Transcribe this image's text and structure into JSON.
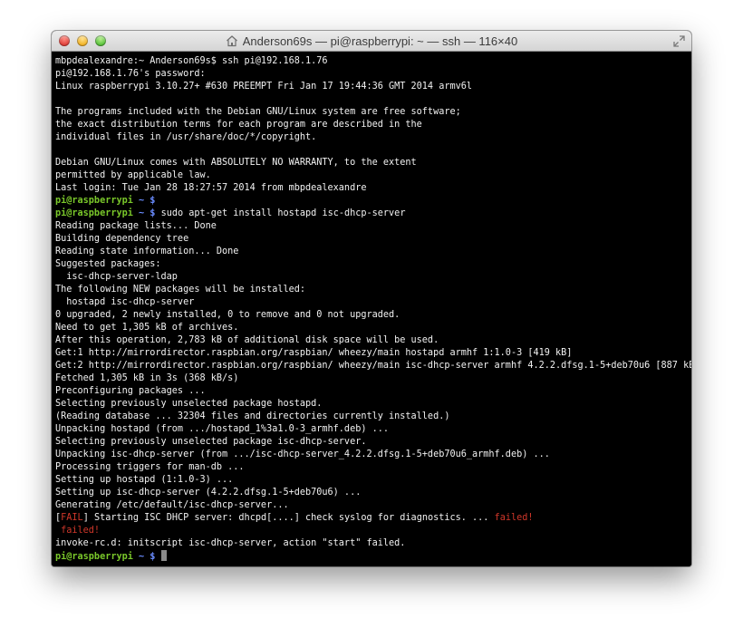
{
  "window": {
    "title": "Anderson69s — pi@raspberrypi: ~ — ssh — 116×40"
  },
  "prompt": {
    "user_host": "pi@raspberrypi",
    "dir": "~",
    "symbol": "$",
    "command": "sudo apt-get install hostapd isc-dhcp-server"
  },
  "terminal": {
    "lines": [
      "mbpdealexandre:~ Anderson69s$ ssh pi@192.168.1.76",
      "pi@192.168.1.76's password:",
      "Linux raspberrypi 3.10.27+ #630 PREEMPT Fri Jan 17 19:44:36 GMT 2014 armv6l",
      "",
      "The programs included with the Debian GNU/Linux system are free software;",
      "the exact distribution terms for each program are described in the",
      "individual files in /usr/share/doc/*/copyright.",
      "",
      "Debian GNU/Linux comes with ABSOLUTELY NO WARRANTY, to the extent",
      "permitted by applicable law.",
      "Last login: Tue Jan 28 18:27:57 2014 from mbpdealexandre"
    ],
    "output": [
      "Reading package lists... Done",
      "Building dependency tree",
      "Reading state information... Done",
      "Suggested packages:",
      "  isc-dhcp-server-ldap",
      "The following NEW packages will be installed:",
      "  hostapd isc-dhcp-server",
      "0 upgraded, 2 newly installed, 0 to remove and 0 not upgraded.",
      "Need to get 1,305 kB of archives.",
      "After this operation, 2,783 kB of additional disk space will be used.",
      "Get:1 http://mirrordirector.raspbian.org/raspbian/ wheezy/main hostapd armhf 1:1.0-3 [419 kB]",
      "Get:2 http://mirrordirector.raspbian.org/raspbian/ wheezy/main isc-dhcp-server armhf 4.2.2.dfsg.1-5+deb70u6 [887 kB]",
      "Fetched 1,305 kB in 3s (368 kB/s)",
      "Preconfiguring packages ...",
      "Selecting previously unselected package hostapd.",
      "(Reading database ... 32304 files and directories currently installed.)",
      "Unpacking hostapd (from .../hostapd_1%3a1.0-3_armhf.deb) ...",
      "Selecting previously unselected package isc-dhcp-server.",
      "Unpacking isc-dhcp-server (from .../isc-dhcp-server_4.2.2.dfsg.1-5+deb70u6_armhf.deb) ...",
      "Processing triggers for man-db ...",
      "Setting up hostapd (1:1.0-3) ...",
      "Setting up isc-dhcp-server (4.2.2.dfsg.1-5+deb70u6) ...",
      "Generating /etc/default/isc-dhcp-server..."
    ],
    "fail_line": {
      "open_bracket": "[",
      "fail": "FAIL",
      "rest": "] Starting ISC DHCP server: dhcpd[....] check syslog for diagnostics. ... ",
      "failed": "failed!"
    },
    "failed_again": " failed!",
    "invoke_line": "invoke-rc.d: initscript isc-dhcp-server, action \"start\" failed."
  },
  "colors": {
    "prompt_user": "#7ac82a",
    "prompt_path": "#6a8cff",
    "error": "#d0372a",
    "background": "#000000",
    "text": "#f2f2f2"
  }
}
